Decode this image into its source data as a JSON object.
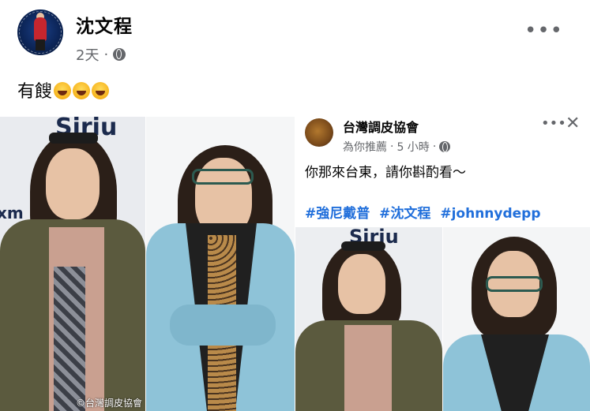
{
  "post": {
    "author": "沈文程",
    "time": "2天",
    "separator": "·",
    "text": "有餿",
    "emoji_count": 3,
    "more": "•••"
  },
  "shared_card": {
    "author": "台灣調皮協會",
    "recommended": "為你推薦",
    "separator": "·",
    "time": "5 小時",
    "dots": "•••",
    "close": "✕",
    "text": "你那來台東，請你斟酌看～",
    "hashtags": [
      "#強尼戴普",
      "#沈文程",
      "#johnnydepp"
    ]
  },
  "image": {
    "logo_text": "Siriu",
    "watermark": "©台灣調皮協會"
  },
  "colors": {
    "hashtag": "#216fdb",
    "secondary_text": "#65676b",
    "jacket_green": "#5b5a3e",
    "jacket_blue": "#8ec3d8"
  }
}
